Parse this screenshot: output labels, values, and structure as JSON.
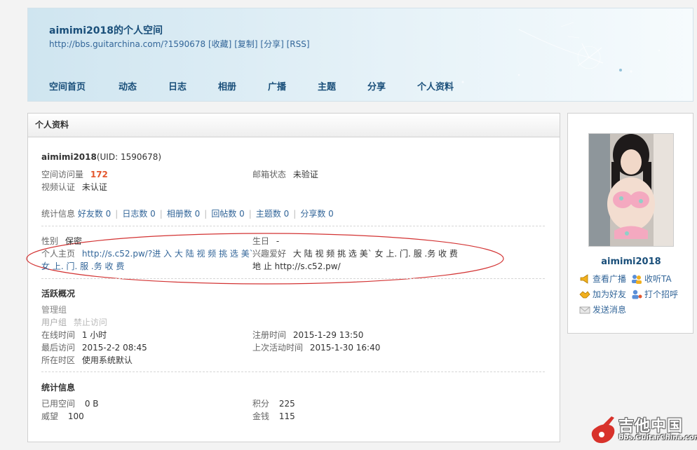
{
  "header": {
    "title": "aimimi2018的个人空间",
    "url": "http://bbs.guitarchina.com/?1590678",
    "links": [
      "[收藏]",
      "[复制]",
      "[分享]",
      "[RSS]"
    ],
    "nav": [
      "空间首页",
      "动态",
      "日志",
      "相册",
      "广播",
      "主题",
      "分享",
      "个人资料"
    ]
  },
  "profile": {
    "panel_title": "个人资料",
    "username": "aimimi2018",
    "uid": "(UID: 1590678)",
    "visits_label": "空间访问量",
    "visits_value": "172",
    "email_label": "邮箱状态",
    "email_value": "未验证",
    "video_label": "视频认证",
    "video_value": "未认证",
    "stats_label": "统计信息",
    "stats": [
      "好友数 0",
      "日志数 0",
      "相册数 0",
      "回帖数 0",
      "主题数 0",
      "分享数 0"
    ],
    "gender_label": "性别",
    "gender_value": "保密",
    "birthday_label": "生日",
    "birthday_value": "-",
    "homepage_label": "个人主页",
    "homepage_line1": "http://s.c52.pw/?进 入 大 陆 视 频 挑 选 美`",
    "homepage_line2": "女 上. 门. 服 .务 收 费",
    "hobby_label": "兴趣爱好",
    "hobby_line1": "大 陆 视 频 挑 选 美` 女 上. 门. 服 .务 收 费",
    "hobby_line2": "地 止 http://s.c52.pw/",
    "activity_title": "活跃概况",
    "admin_group": "管理组",
    "user_group_label": "用户组",
    "user_group_value": "禁止访问",
    "online_label": "在线时间",
    "online_value": "1 小时",
    "register_label": "注册时间",
    "register_value": "2015-1-29 13:50",
    "last_visit_label": "最后访问",
    "last_visit_value": "2015-2-2 08:45",
    "last_active_label": "上次活动时间",
    "last_active_value": "2015-1-30 16:40",
    "timezone_label": "所在时区",
    "timezone_value": "使用系统默认",
    "stat_info_title": "统计信息",
    "space_label": "已用空间",
    "space_value": "0 B",
    "points_label": "积分",
    "points_value": "225",
    "prestige_label": "威望",
    "prestige_value": "100",
    "money_label": "金钱",
    "money_value": "115"
  },
  "sidebar": {
    "username": "aimimi2018",
    "actions": [
      "查看广播",
      "收听TA",
      "加为好友",
      "打个招呼",
      "发送消息"
    ]
  },
  "watermark": {
    "title": "吉他中国",
    "sub": "bbs.GuitarChina.com"
  },
  "colors": {
    "link": "#336699",
    "nav": "#1a4f7a",
    "accent": "#e4572e",
    "annotation_ring": "#d33333"
  }
}
